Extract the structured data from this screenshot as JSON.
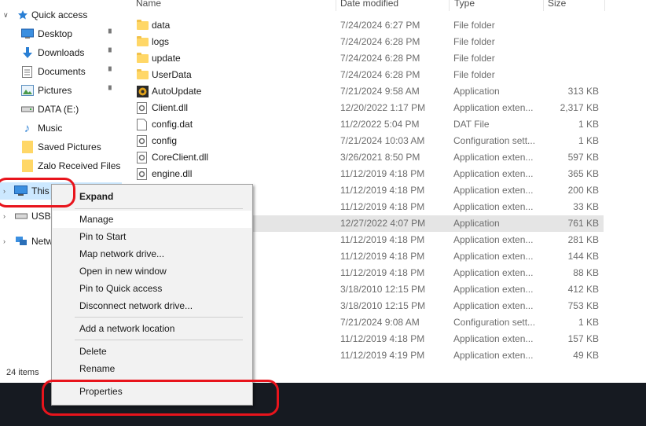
{
  "window": {
    "status_items": "24 items"
  },
  "nav": {
    "quick_access": "Quick access",
    "items": [
      {
        "label": "Desktop",
        "icon": "desktop-icon",
        "pinned": true
      },
      {
        "label": "Downloads",
        "icon": "download-arrow-icon",
        "pinned": true
      },
      {
        "label": "Documents",
        "icon": "documents-icon",
        "pinned": true
      },
      {
        "label": "Pictures",
        "icon": "pictures-icon",
        "pinned": true
      },
      {
        "label": "DATA (E:)",
        "icon": "drive-icon",
        "pinned": false
      },
      {
        "label": "Music",
        "icon": "music-note-icon",
        "pinned": false
      },
      {
        "label": "Saved Pictures",
        "icon": "folder-icon",
        "pinned": false
      },
      {
        "label": "Zalo Received Files",
        "icon": "folder-icon",
        "pinned": false
      },
      {
        "label": "This",
        "icon": "this-pc-icon",
        "pinned": false
      },
      {
        "label": "USB",
        "icon": "usb-drive-icon",
        "pinned": false
      },
      {
        "label": "Netw",
        "icon": "network-icon",
        "pinned": false
      }
    ],
    "pin_glyph": "📌"
  },
  "columns": {
    "name": "Name",
    "date": "Date modified",
    "type": "Type",
    "size": "Size"
  },
  "files": [
    {
      "name": "data",
      "date": "7/24/2024 6:27 PM",
      "type": "File folder",
      "size": "",
      "icon": "folder"
    },
    {
      "name": "logs",
      "date": "7/24/2024 6:28 PM",
      "type": "File folder",
      "size": "",
      "icon": "folder"
    },
    {
      "name": "update",
      "date": "7/24/2024 6:28 PM",
      "type": "File folder",
      "size": "",
      "icon": "folder"
    },
    {
      "name": "UserData",
      "date": "7/24/2024 6:28 PM",
      "type": "File folder",
      "size": "",
      "icon": "folder"
    },
    {
      "name": "AutoUpdate",
      "date": "7/21/2024 9:58 AM",
      "type": "Application",
      "size": "313 KB",
      "icon": "app"
    },
    {
      "name": "Client.dll",
      "date": "12/20/2022 1:17 PM",
      "type": "Application exten...",
      "size": "2,317 KB",
      "icon": "dll"
    },
    {
      "name": "config.dat",
      "date": "11/2/2022 5:04 PM",
      "type": "DAT File",
      "size": "1 KB",
      "icon": "file"
    },
    {
      "name": "config",
      "date": "7/21/2024 10:03 AM",
      "type": "Configuration sett...",
      "size": "1 KB",
      "icon": "dll"
    },
    {
      "name": "CoreClient.dll",
      "date": "3/26/2021 8:50 PM",
      "type": "Application exten...",
      "size": "597 KB",
      "icon": "dll"
    },
    {
      "name": "engine.dll",
      "date": "11/12/2019 4:18 PM",
      "type": "Application exten...",
      "size": "365 KB",
      "icon": "dll"
    },
    {
      "name": "",
      "date": "11/12/2019 4:18 PM",
      "type": "Application exten...",
      "size": "200 KB",
      "icon": ""
    },
    {
      "name": "",
      "date": "11/12/2019 4:18 PM",
      "type": "Application exten...",
      "size": "33 KB",
      "icon": ""
    },
    {
      "name": "",
      "date": "12/27/2022 4:07 PM",
      "type": "Application",
      "size": "761 KB",
      "icon": "",
      "selected": true
    },
    {
      "name": "",
      "date": "11/12/2019 4:18 PM",
      "type": "Application exten...",
      "size": "281 KB",
      "icon": ""
    },
    {
      "name": "",
      "date": "11/12/2019 4:18 PM",
      "type": "Application exten...",
      "size": "144 KB",
      "icon": ""
    },
    {
      "name": "",
      "date": "11/12/2019 4:18 PM",
      "type": "Application exten...",
      "size": "88 KB",
      "icon": ""
    },
    {
      "name": "",
      "date": "3/18/2010 12:15 PM",
      "type": "Application exten...",
      "size": "412 KB",
      "icon": ""
    },
    {
      "name": "",
      "date": "3/18/2010 12:15 PM",
      "type": "Application exten...",
      "size": "753 KB",
      "icon": ""
    },
    {
      "name": "",
      "date": "7/21/2024 9:08 AM",
      "type": "Configuration sett...",
      "size": "1 KB",
      "icon": ""
    },
    {
      "name": "",
      "date": "11/12/2019 4:18 PM",
      "type": "Application exten...",
      "size": "157 KB",
      "icon": ""
    },
    {
      "name": "",
      "date": "11/12/2019 4:19 PM",
      "type": "Application exten...",
      "size": "49 KB",
      "icon": ""
    }
  ],
  "context_menu": {
    "items": [
      {
        "label": "Expand",
        "bold": true
      },
      {
        "label": "Manage",
        "highlighted": true
      },
      {
        "label": "Pin to Start"
      },
      {
        "label": "Map network drive..."
      },
      {
        "label": "Open in new window"
      },
      {
        "label": "Pin to Quick access"
      },
      {
        "label": "Disconnect network drive..."
      },
      {
        "label": "Add a network location"
      },
      {
        "label": "Delete"
      },
      {
        "label": "Rename"
      },
      {
        "label": "Properties"
      }
    ]
  },
  "colors": {
    "selection": "#cce8ff",
    "row_selected": "#e5e5e5",
    "annotation": "#e8141c",
    "folder": "#ffd767",
    "taskbar": "#161a21"
  }
}
